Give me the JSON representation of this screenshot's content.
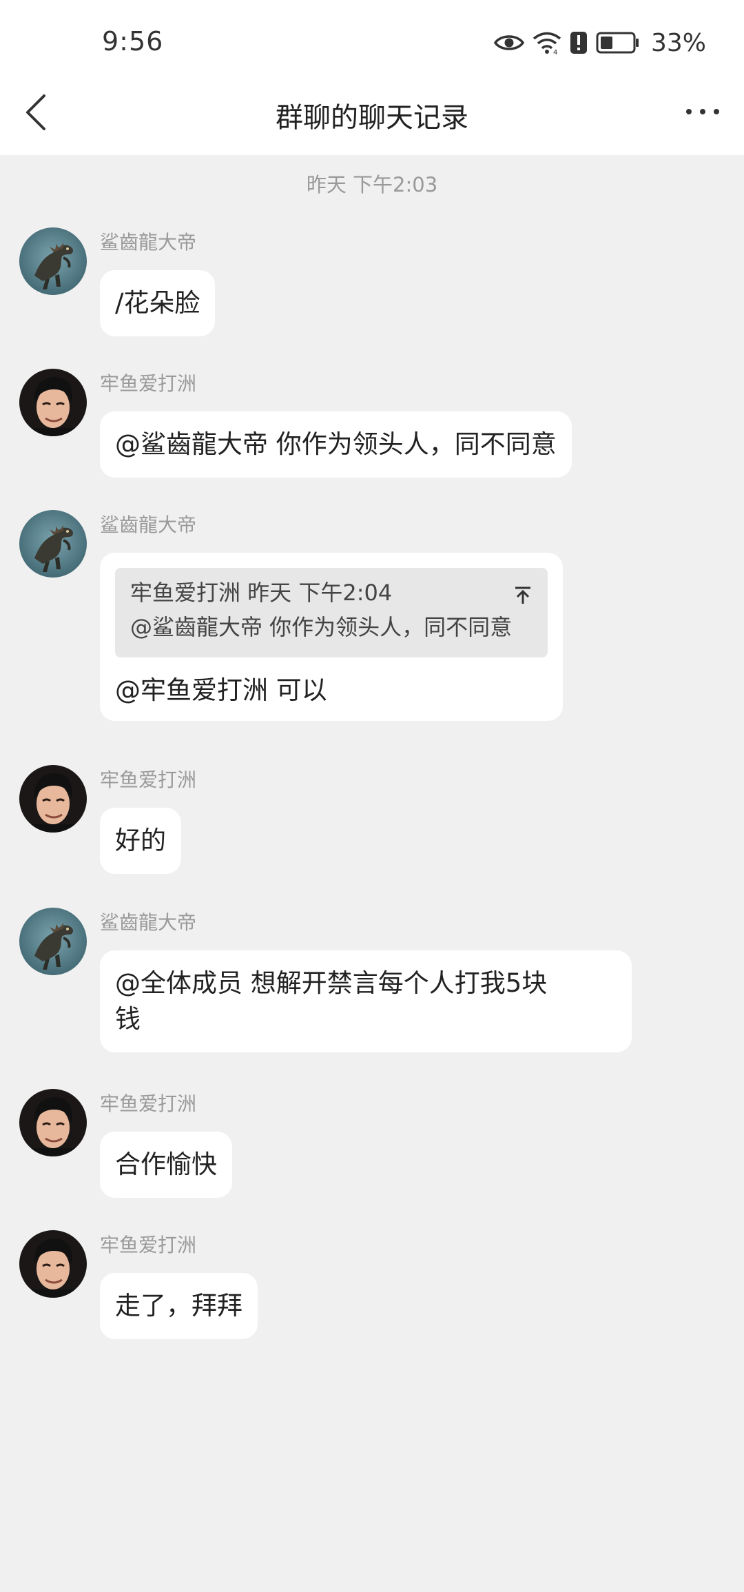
{
  "status_bar": {
    "time": "9:56",
    "battery_percent": "33%",
    "icons": [
      "eye-icon",
      "wifi-icon",
      "alert-icon",
      "battery-icon"
    ]
  },
  "header": {
    "title": "群聊的聊天记录",
    "back_icon": "chevron-left-icon",
    "more_icon": "more-horizontal-icon"
  },
  "chat": {
    "time_divider": "昨天 下午2:03",
    "messages": [
      {
        "sender": "鲨齒龍大帝",
        "avatar": "dinosaur-avatar",
        "text": "/花朵脸"
      },
      {
        "sender": "牢鱼爱打洲",
        "avatar": "person-avatar",
        "text": "@鲨齒龍大帝 你作为领头人，同不同意"
      },
      {
        "sender": "鲨齒龍大帝",
        "avatar": "dinosaur-avatar",
        "quote": {
          "header": "牢鱼爱打洲 昨天 下午2:04",
          "text": "@鲨齒龍大帝 你作为领头人，同不同意"
        },
        "text": "@牢鱼爱打洲 可以"
      },
      {
        "sender": "牢鱼爱打洲",
        "avatar": "person-avatar",
        "text": "好的"
      },
      {
        "sender": "鲨齒龍大帝",
        "avatar": "dinosaur-avatar",
        "text_line1": "@全体成员 想解开禁言每个人打我5块",
        "text_line2": "钱"
      },
      {
        "sender": "牢鱼爱打洲",
        "avatar": "person-avatar",
        "text": "合作愉快"
      },
      {
        "sender": "牢鱼爱打洲",
        "avatar": "person-avatar",
        "text": "走了，拜拜"
      }
    ]
  },
  "colors": {
    "background": "#f0f0f0",
    "bubble": "#ffffff",
    "quote_bg": "#e7e7e7",
    "sender_name": "#9a9a9a"
  }
}
